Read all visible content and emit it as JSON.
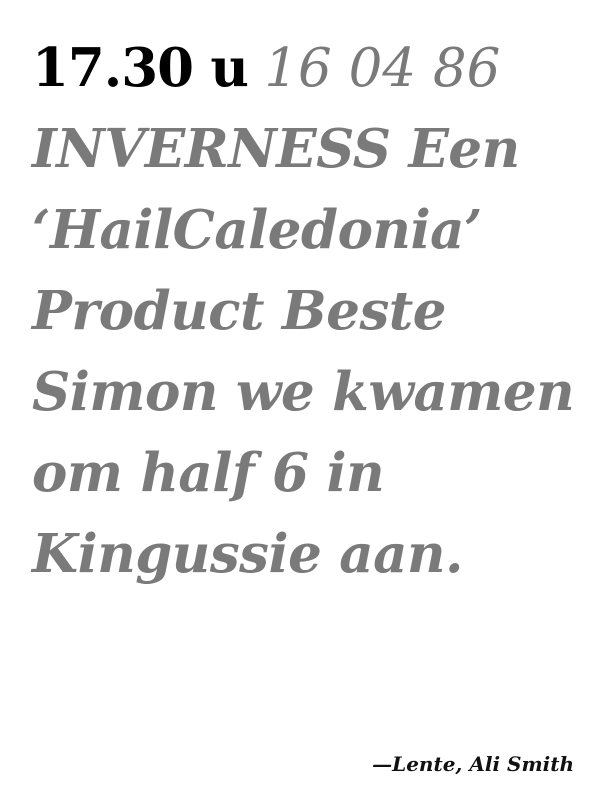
{
  "quote": {
    "time": "17.30 u",
    "date": "16 04 86",
    "text": "INVERNESS Een ‘HailCaledonia’ Product Beste Simon we kwamen om half 6 in Kingussie aan."
  },
  "attribution": "—Lente, Ali Smith",
  "colors": {
    "time": "#000000",
    "text": "#7a7a7a",
    "background": "#ffffff"
  }
}
